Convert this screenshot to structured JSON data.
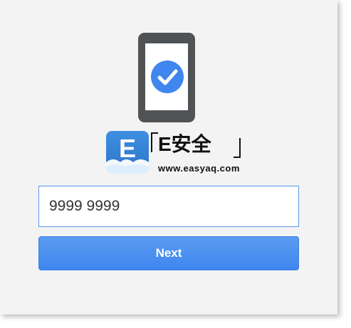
{
  "illustration": {
    "phone_icon": "smartphone-icon",
    "check_icon": "checkmark-circle-icon",
    "accent_color": "#3f86ee"
  },
  "watermark": {
    "brand_text": "E安全",
    "url_text": "www.easyaq.com",
    "logo_letter": "E",
    "logo_color": "#2b74c9"
  },
  "form": {
    "phone_value": "9999 9999",
    "next_label": "Next",
    "button_color": "#4a8ff0",
    "input_border_color": "#5a96e6"
  }
}
